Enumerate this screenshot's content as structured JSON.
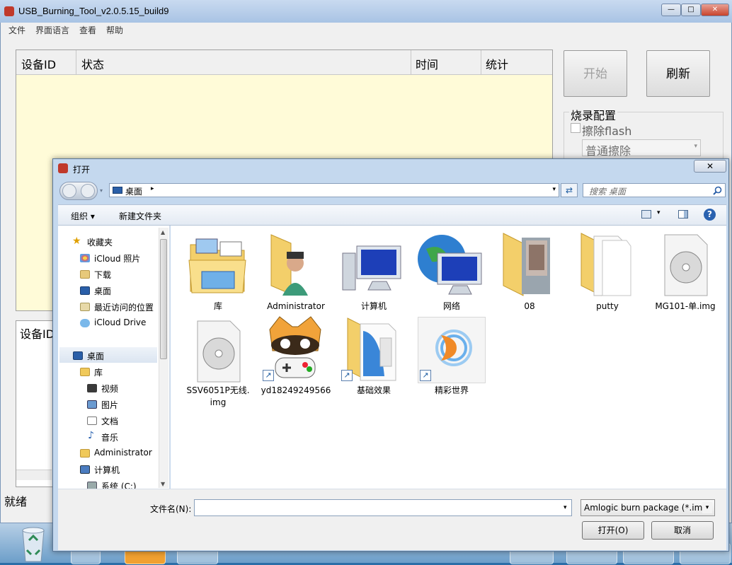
{
  "app": {
    "title": "USB_Burning_Tool_v2.0.5.15_build9",
    "menu": [
      "文件",
      "界面语言",
      "查看",
      "帮助"
    ],
    "table_headers": [
      "设备ID",
      "状态",
      "时间",
      "统计"
    ],
    "start_button": "开始",
    "refresh_button": "刷新",
    "burn_config_label": "烧录配置",
    "erase_flash_label": "擦除flash",
    "erase_mode": "普通擦除",
    "lower_table_header": "设备ID",
    "status_text": "就绪",
    "window_controls": [
      "—",
      "□",
      "✕"
    ]
  },
  "dialog": {
    "title": "打开",
    "close_label": "✕",
    "address_location": "桌面",
    "search_placeholder": "搜索 桌面",
    "toolbar": {
      "organize": "组织 ▾",
      "new_folder": "新建文件夹"
    },
    "nav": {
      "favorites": "收藏夹",
      "items_fav": [
        "iCloud 照片",
        "下载",
        "桌面",
        "最近访问的位置",
        "iCloud Drive"
      ],
      "desktop": "桌面",
      "library": "库",
      "items_lib": [
        "视频",
        "图片",
        "文档",
        "音乐"
      ],
      "admin": "Administrator",
      "computer": "计算机",
      "system_drive": "系统 (C:)"
    },
    "files": [
      {
        "name": "库",
        "icon": "library-folder-icon"
      },
      {
        "name": "Administrator",
        "icon": "user-folder-icon"
      },
      {
        "name": "计算机",
        "icon": "computer-icon"
      },
      {
        "name": "网络",
        "icon": "network-icon"
      },
      {
        "name": "08",
        "icon": "photo-folder-icon"
      },
      {
        "name": "putty",
        "icon": "folder-icon"
      },
      {
        "name": "MG101-单.img",
        "icon": "disc-image-icon"
      },
      {
        "name": "SSV6051P无线.",
        "name2": "img",
        "icon": "disc-image-icon"
      },
      {
        "name": "yd18249249566",
        "icon": "game-shortcut-icon"
      },
      {
        "name": "基础效果",
        "icon": "folder-shortcut-icon"
      },
      {
        "name": "精彩世界",
        "icon": "media-shortcut-icon"
      }
    ],
    "filename_label": "文件名(N):",
    "filename_value": "",
    "filetype_value": "Amlogic burn package (*.img",
    "open_button": "打开(O)",
    "cancel_button": "取消"
  },
  "colors": {
    "title_bar": "#a8c3e4",
    "table_bg": "#fffbd8",
    "dialog_frame": "#c4d8ee"
  }
}
